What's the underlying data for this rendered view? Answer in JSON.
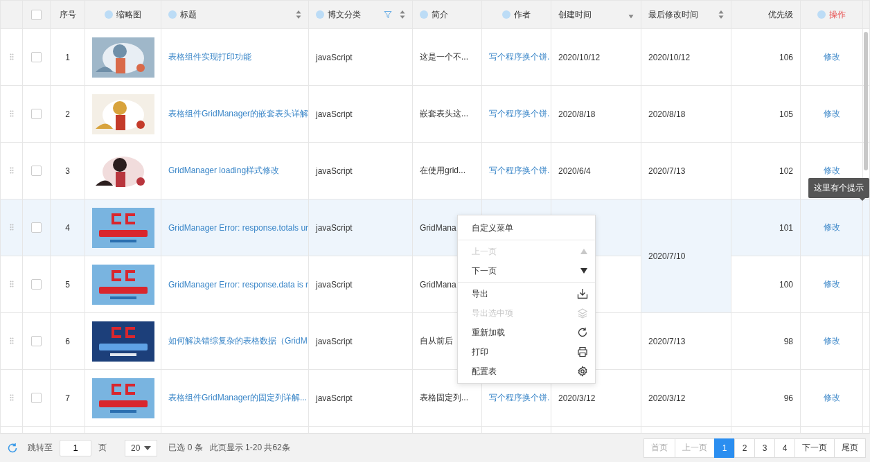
{
  "header": {
    "checked": false,
    "columns": [
      {
        "label": "序号",
        "remind": false
      },
      {
        "label": "缩略图",
        "remind": true
      },
      {
        "label": "标题",
        "remind": true,
        "sortable": true
      },
      {
        "label": "博文分类",
        "remind": true,
        "sortable": true,
        "filter": true
      },
      {
        "label": "简介",
        "remind": true
      },
      {
        "label": "作者",
        "remind": true
      },
      {
        "label": "创建时间",
        "remind": false,
        "sortable": true,
        "sorted_desc": true
      },
      {
        "label": "最后修改时间",
        "remind": false,
        "sortable": true
      },
      {
        "label": "优先级",
        "remind": false
      },
      {
        "label": "操作",
        "remind": true,
        "kind": "action"
      }
    ]
  },
  "rows": [
    {
      "index": "1",
      "checked": false,
      "highlighted": false,
      "title": "表格组件实现打印功能",
      "category": "javaScript",
      "intro": "这是一个不...",
      "author": "写个程序换个饼.",
      "created": "2020/10/12",
      "modified": "2020/10/12",
      "priority": "106",
      "action": "修改"
    },
    {
      "index": "2",
      "checked": false,
      "highlighted": false,
      "title": "表格组件GridManager的嵌套表头详解",
      "category": "javaScript",
      "intro": "嵌套表头这...",
      "author": "写个程序换个饼.",
      "created": "2020/8/18",
      "modified": "2020/8/18",
      "priority": "105",
      "action": "修改"
    },
    {
      "index": "3",
      "checked": false,
      "highlighted": false,
      "title": "GridManager loading样式修改",
      "category": "javaScript",
      "intro": "在使用grid...",
      "author": "写个程序换个饼.",
      "created": "2020/6/4",
      "modified": "2020/7/13",
      "priority": "102",
      "action": "修改"
    },
    {
      "index": "4",
      "checked": false,
      "highlighted": true,
      "title": "GridManager Error: response.totals ur",
      "category": "javaScript",
      "intro": "GridMana",
      "modified": "2020/7/10",
      "modified_merged": true,
      "priority": "101",
      "action": "修改"
    },
    {
      "index": "5",
      "checked": false,
      "highlighted": false,
      "title": "GridManager Error: response.data is r",
      "category": "javaScript",
      "intro": "GridMana",
      "priority": "100",
      "action": "修改"
    },
    {
      "index": "6",
      "checked": false,
      "highlighted": false,
      "title": "如何解决错综复杂的表格数据（GridM",
      "category": "javaScript",
      "intro": "自从前后",
      "modified": "2020/7/13",
      "priority": "98",
      "action": "修改"
    },
    {
      "index": "7",
      "checked": false,
      "highlighted": false,
      "title": "表格组件GridManager的固定列详解...",
      "category": "javaScript",
      "intro": "表格固定列...",
      "author": "写个程序换个饼.",
      "created": "2020/3/12",
      "modified": "2020/3/12",
      "priority": "96",
      "action": "修改"
    }
  ],
  "tooltip": "这里有个提示",
  "menu": [
    {
      "label": "自定义菜单",
      "kind": "title",
      "disabled": false
    },
    {
      "label": "上一页",
      "kind": "item",
      "disabled": true
    },
    {
      "label": "下一页",
      "kind": "item",
      "disabled": false,
      "divider_after": true
    },
    {
      "label": "导出",
      "kind": "item",
      "disabled": false
    },
    {
      "label": "导出选中项",
      "kind": "item",
      "disabled": true
    },
    {
      "label": "重新加载",
      "kind": "item",
      "disabled": false
    },
    {
      "label": "打印",
      "kind": "item",
      "disabled": false
    },
    {
      "label": "配置表",
      "kind": "item",
      "disabled": false
    }
  ],
  "footer": {
    "goto_label": "跳转至",
    "page_value": "1",
    "page_unit": "页",
    "page_size": "20",
    "selected_info": "已选 0 条",
    "range_info": "此页显示 1-20 共62条",
    "pages": [
      {
        "label": "首页",
        "selected": false,
        "disabled": true
      },
      {
        "label": "上一页",
        "selected": false,
        "disabled": true
      },
      {
        "label": "1",
        "selected": true,
        "disabled": false
      },
      {
        "label": "2",
        "selected": false,
        "disabled": false
      },
      {
        "label": "3",
        "selected": false,
        "disabled": false
      },
      {
        "label": "4",
        "selected": false,
        "disabled": false
      },
      {
        "label": "下一页",
        "selected": false,
        "disabled": false
      },
      {
        "label": "尾页",
        "selected": false,
        "disabled": false
      }
    ]
  }
}
